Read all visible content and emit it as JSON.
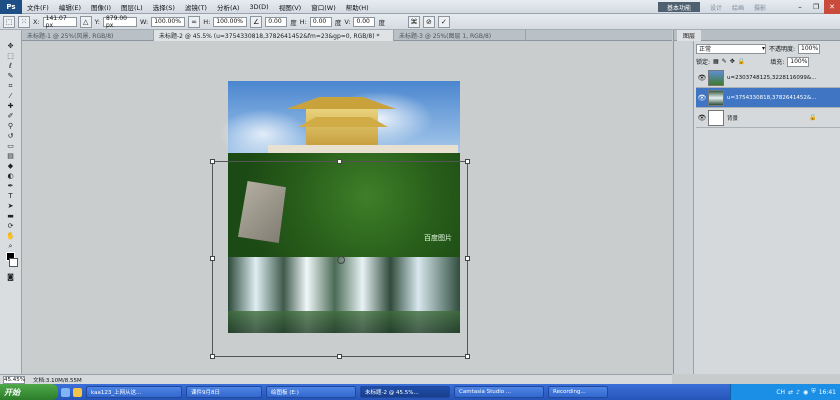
{
  "menubar": {
    "logo": "Ps",
    "items": [
      "文件(F)",
      "编辑(E)",
      "图像(I)",
      "图层(L)",
      "选择(S)",
      "滤镜(T)",
      "分析(A)",
      "3D(D)",
      "视图(V)",
      "窗口(W)",
      "帮助(H)"
    ],
    "workspace_active": "基本功能",
    "workspace_links": [
      "设计",
      "绘画",
      "摄影"
    ],
    "window_controls": {
      "minimize": "–",
      "restore": "❐",
      "close": "✕"
    }
  },
  "options": {
    "x_label": "X:",
    "x_value": "141.07 px",
    "y_label": "Y:",
    "y_value": "879.00 px",
    "w_label": "W:",
    "w_value": "100.00%",
    "h_label": "H:",
    "h_value": "100.00%",
    "angle_value": "0.00",
    "angle_unit": "度",
    "hskew_label": "H:",
    "hskew_value": "0.00",
    "hskew_unit": "度",
    "vskew_label": "V:",
    "vskew_value": "0.00",
    "vskew_unit": "度"
  },
  "tabs": [
    {
      "label": "未标题-1 @ 25%(风景, RGB/8)",
      "active": false
    },
    {
      "label": "未标题-2 @ 45.5% (u=3754330818,3782641452&fm=23&gp=0, RGB/8) *",
      "active": true
    },
    {
      "label": "未标题-3 @ 25%(图层 1, RGB/8)",
      "active": false
    }
  ],
  "document": {
    "watermark": "百度图片"
  },
  "status": {
    "zoom": "45.45%",
    "doc_info": "文档:3.10M/8.55M"
  },
  "panel": {
    "tab_label": "图层",
    "blend_mode": "正常",
    "opacity_label": "不透明度:",
    "opacity_value": "100%",
    "lock_label": "锁定:",
    "fill_label": "填充:",
    "fill_value": "100%",
    "layers": [
      {
        "name": "u=2303748125,3228116099&...",
        "selected": false
      },
      {
        "name": "u=3754330818,3782641452&...",
        "selected": true
      },
      {
        "name": "背景",
        "selected": false
      }
    ]
  },
  "taskbar": {
    "start_label": "开始",
    "tasks": [
      {
        "label": "kaa123_上网从这...",
        "active": false
      },
      {
        "label": "课件9月8日",
        "active": false
      },
      {
        "label": "绘图板 (E:)",
        "active": false
      },
      {
        "label": "未标题-2 @ 45.5%...",
        "active": true
      },
      {
        "label": "Camtasia Studio ...",
        "active": false
      },
      {
        "label": "Recording...",
        "active": false
      }
    ],
    "tray_lang": "CH",
    "clock": "16:41"
  },
  "colors": {
    "accent_selected_layer": "#3f75c2",
    "taskbar_blue": "#2655b8",
    "start_green": "#2c7d2a"
  }
}
